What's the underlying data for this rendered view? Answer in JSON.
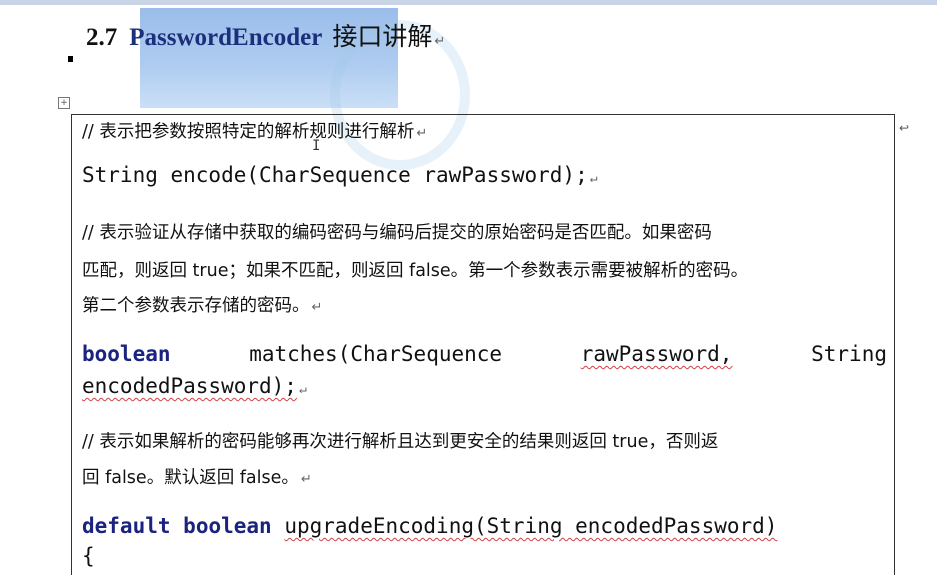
{
  "heading": {
    "number": "2.7",
    "class_name": "PasswordEncoder",
    "suffix": "接口讲解"
  },
  "paragraph_mark": "↵",
  "cell_end_mark": "↩",
  "items": {
    "comment1": "//  表示把参数按照特定的解析规则进行解析",
    "code1": "String encode(CharSequence rawPassword);",
    "comment2_line1": "//  表示验证从存储中获取的编码密码与编码后提交的原始密码是否匹配。如果密码",
    "comment2_line2": "匹配，则返回 true；如果不匹配，则返回 false。第一个参数表示需要被解析的密码。",
    "comment2_line3": "第二个参数表示存储的密码。",
    "code2_kw": "boolean",
    "code2_method": "matches(CharSequence",
    "code2_param": "rawPassword,",
    "code2_type": "String",
    "code2_line2": "encodedPassword);",
    "comment3_line1": "//  表示如果解析的密码能够再次进行解析且达到更安全的结果则返回 true，否则返",
    "comment3_line2": "回 false。默认返回 false。",
    "code3_kw1": "default",
    "code3_kw2": "boolean",
    "code3_rest": "upgradeEncoding(String encodedPassword)",
    "code3_line2": "{"
  }
}
